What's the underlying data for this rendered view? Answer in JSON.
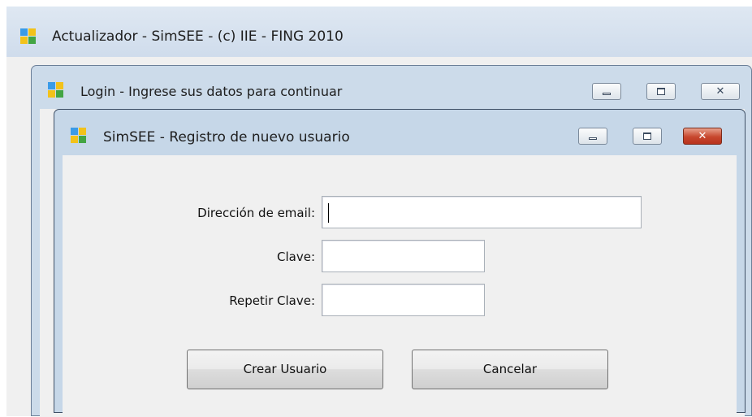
{
  "updater_window": {
    "title": "Actualizador - SimSEE - (c) IIE - FING  2010",
    "icon": "simsee-logo-icon"
  },
  "login_window": {
    "title": "Login - Ingrese sus datos para continuar",
    "icon": "simsee-logo-icon",
    "controls": [
      "minimize-icon",
      "maximize-icon",
      "close-icon"
    ]
  },
  "register_dialog": {
    "title": "SimSEE - Registro de nuevo usuario",
    "icon": "simsee-logo-icon",
    "controls": [
      "minimize-icon",
      "maximize-icon",
      "close-icon"
    ],
    "close_button_color": "#c7472e",
    "fields": {
      "email": {
        "label": "Dirección de email:",
        "value": ""
      },
      "password": {
        "label": "Clave:",
        "value": ""
      },
      "repeat_password": {
        "label": "Repetir Clave:",
        "value": ""
      }
    },
    "buttons": {
      "create": "Crear Usuario",
      "cancel": "Cancelar"
    }
  }
}
